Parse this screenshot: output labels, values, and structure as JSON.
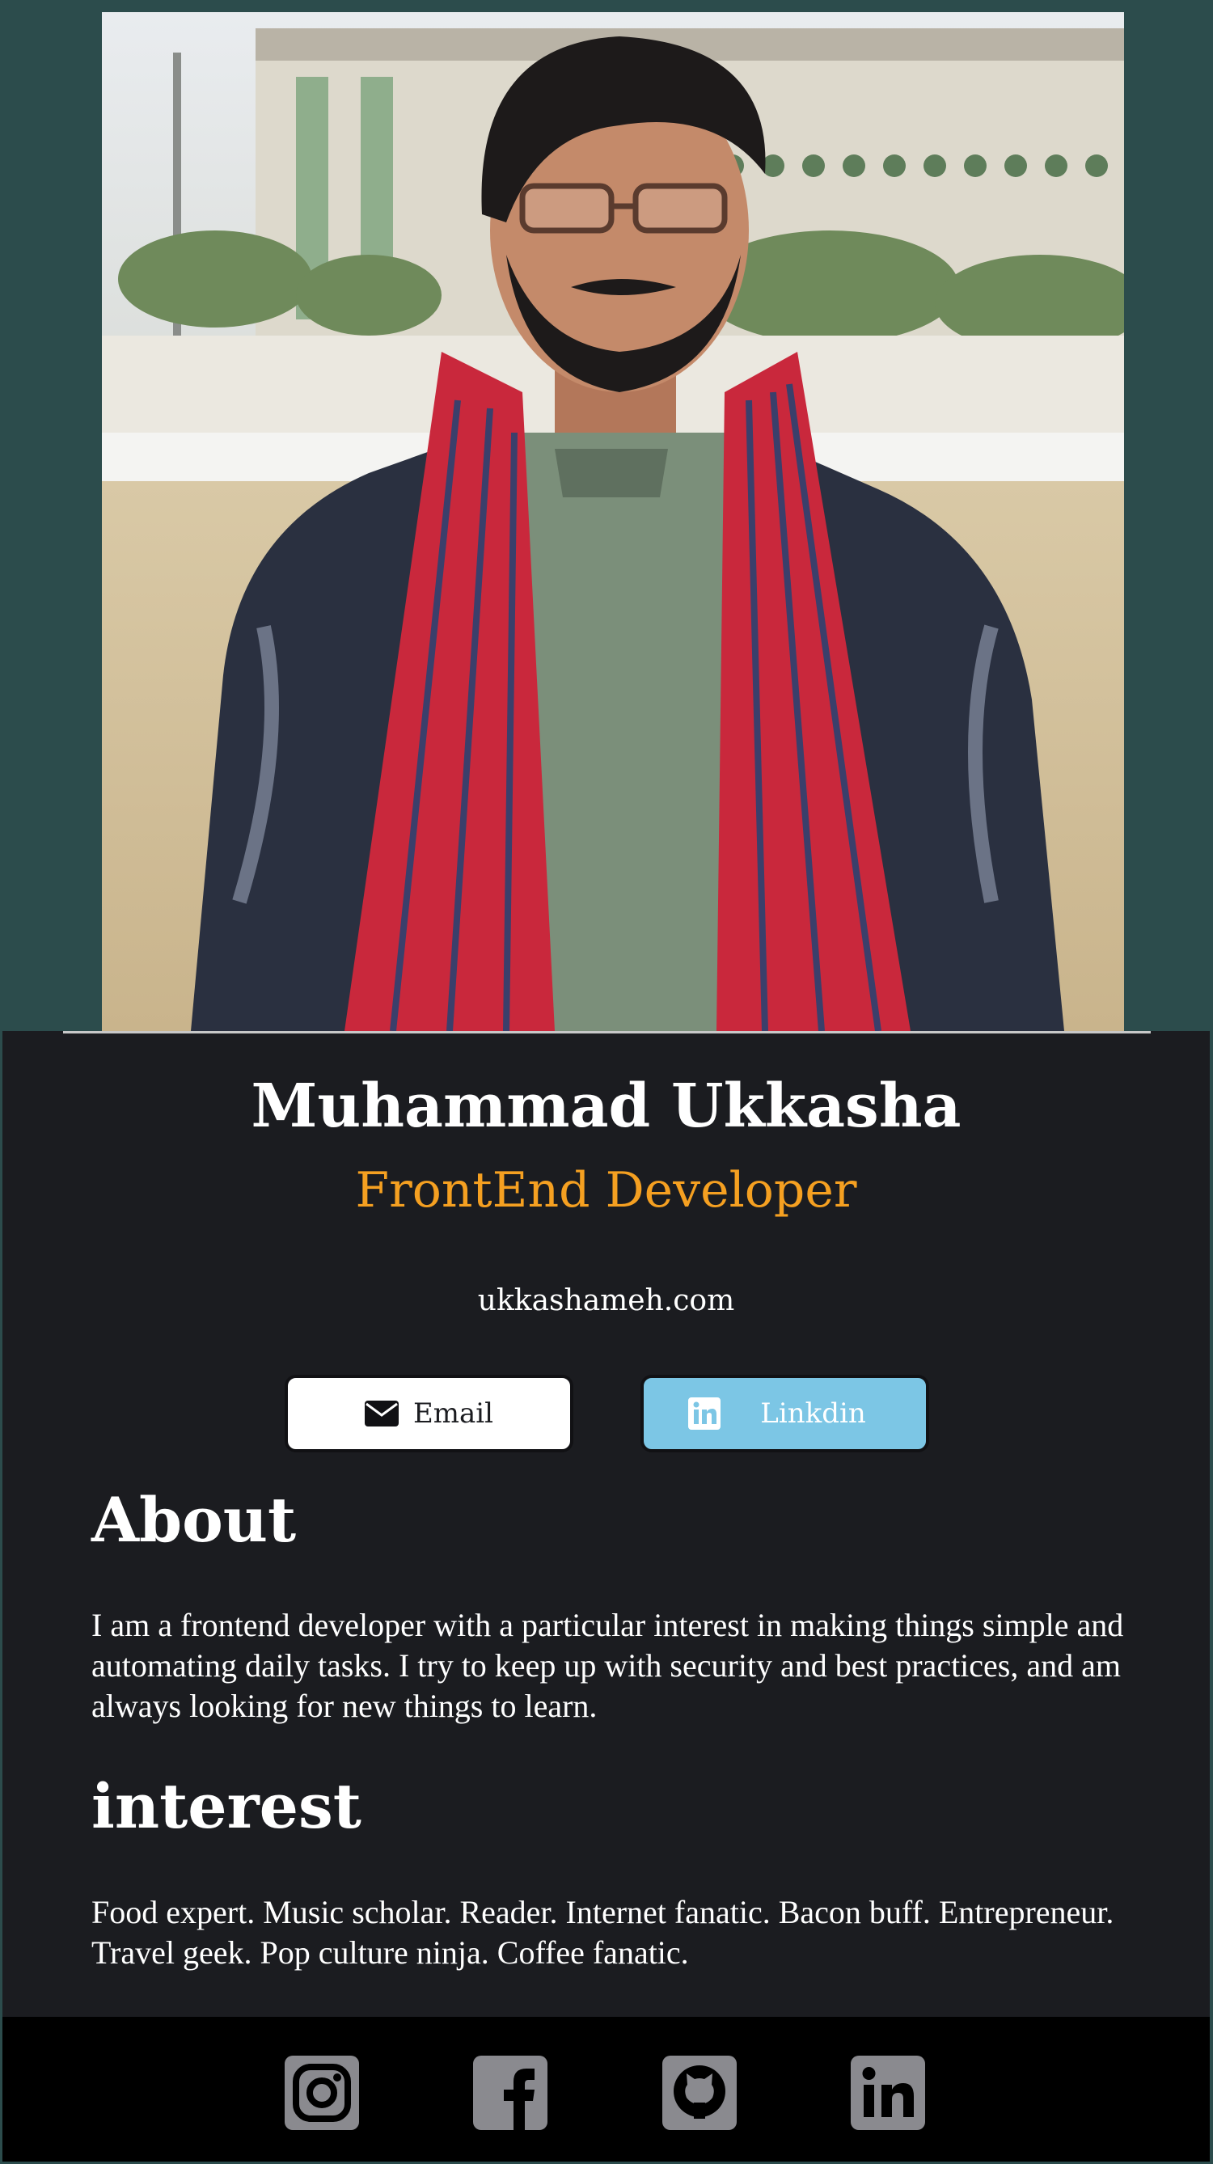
{
  "profile": {
    "name": "Muhammad Ukkasha",
    "role": "FrontEnd Developer",
    "website": "ukkashameh.com",
    "photo_icon": "profile-photo"
  },
  "buttons": {
    "email_label": "Email",
    "email_icon": "envelope-icon",
    "linkedin_label": "Linkdin",
    "linkedin_icon": "linkedin-icon"
  },
  "about": {
    "heading": "About",
    "text": "I am a frontend developer with a particular interest in making things simple and automating daily tasks. I try to keep up with security and best practices, and am always looking for new things to learn."
  },
  "interest": {
    "heading": "interest",
    "text": "Food expert. Music scholar. Reader. Internet fanatic. Bacon buff. Entrepreneur. Travel geek. Pop culture ninja. Coffee fanatic."
  },
  "footer": {
    "icons": [
      "instagram-icon",
      "facebook-icon",
      "github-icon",
      "linkedin-icon"
    ]
  },
  "colors": {
    "page_bg": "#2c4c4c",
    "card_bg": "#1b1c20",
    "accent": "#f5a021",
    "linkedin_button": "#7cc6e5",
    "footer_icon": "#8a8a8f"
  }
}
